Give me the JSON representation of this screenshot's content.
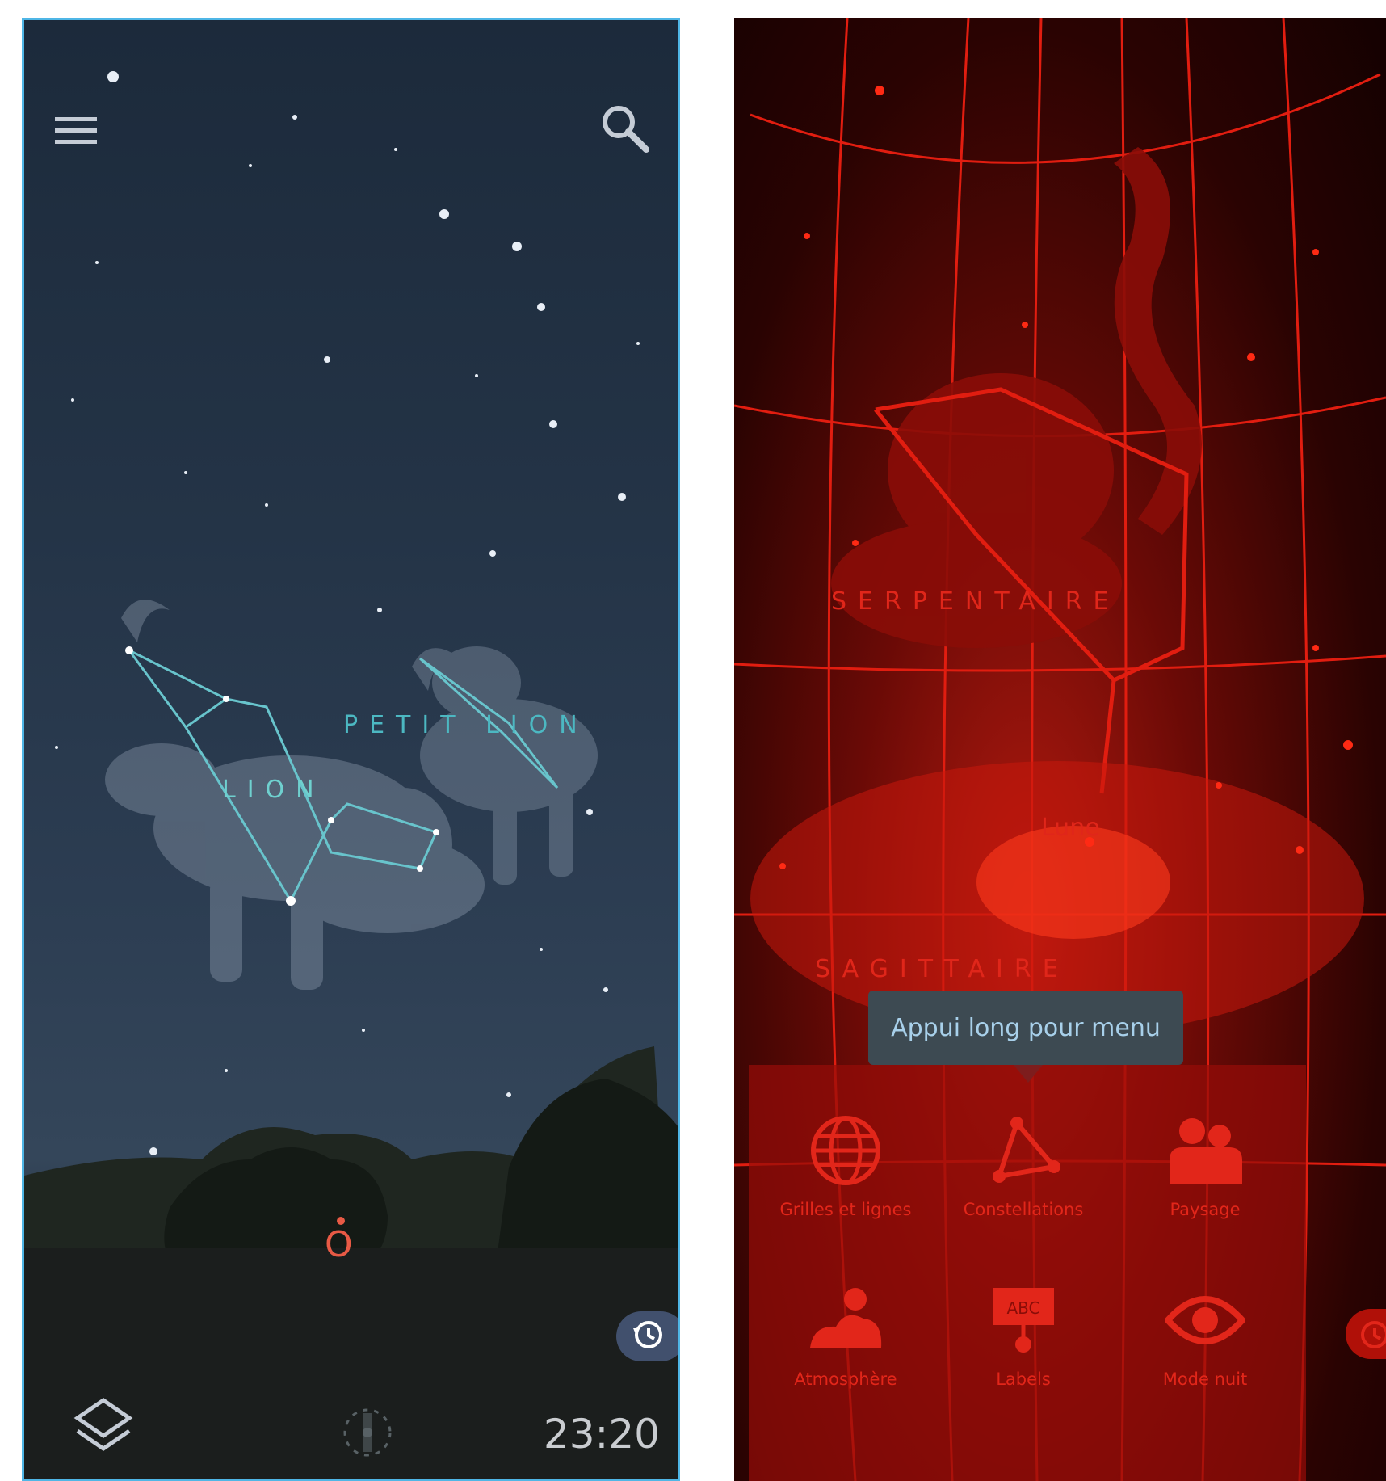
{
  "left_screen": {
    "constellations": [
      {
        "label": "LION",
        "color": "#6fd0cf"
      },
      {
        "label": "PETIT LION",
        "color": "#4cb8c2"
      }
    ],
    "compass_letter": "O",
    "compass_color": "#e85a45",
    "clock": "23:20",
    "icons": {
      "menu": "hamburger-menu-icon",
      "search": "search-icon",
      "layers": "layers-icon",
      "time": "history-icon",
      "gyro": "gyroscope-icon"
    }
  },
  "right_screen": {
    "mode": "night",
    "constellations": [
      {
        "label": "SERPENTAIRE"
      },
      {
        "label": "SAGITTAIRE"
      }
    ],
    "moon_label": "Lune",
    "tooltip": "Appui long pour menu",
    "menu": [
      {
        "label": "Grilles et lignes",
        "icon": "globe-icon"
      },
      {
        "label": "Constellations",
        "icon": "constellation-triangle-icon"
      },
      {
        "label": "Paysage",
        "icon": "landscape-people-icon"
      },
      {
        "label": "Atmosphère",
        "icon": "cloud-sun-icon"
      },
      {
        "label": "Labels",
        "icon": "abc-label-icon"
      },
      {
        "label": "Mode nuit",
        "icon": "eye-icon"
      }
    ],
    "accent_color": "#e2261a"
  }
}
